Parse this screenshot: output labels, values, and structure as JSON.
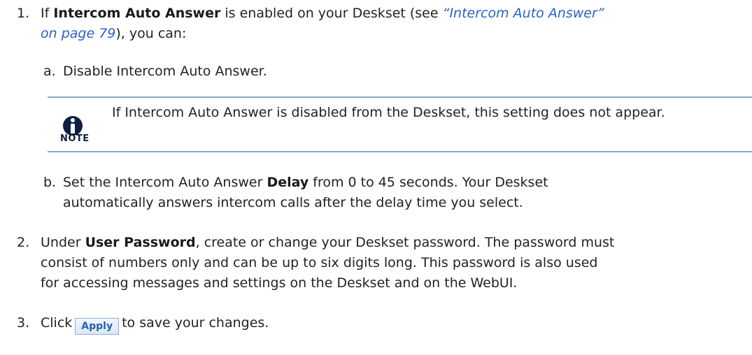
{
  "step1": {
    "number": "1.",
    "prefix": "If ",
    "bold": "Intercom Auto Answer",
    "middle": " is enabled on your Deskset (see ",
    "link_line1": "“Intercom Auto Answer”",
    "link_line2": "on page 79",
    "suffix": "), you can:"
  },
  "substep_a": {
    "letter": "a.",
    "text": "Disable Intercom Auto Answer."
  },
  "note": {
    "icon": "info-icon",
    "label": "NOTE",
    "text": "If Intercom Auto Answer is disabled from the Deskset, this setting does not appear."
  },
  "substep_b": {
    "letter": "b.",
    "prefix": "Set the Intercom Auto Answer ",
    "bold": "Delay",
    "suffix": " from 0 to 45 seconds. Your Deskset",
    "line2": "automatically answers intercom calls after the delay time you select."
  },
  "step2": {
    "number": "2.",
    "prefix": "Under ",
    "bold": "User Password",
    "suffix": ", create or change your Deskset password. The password must",
    "line2": "consist of numbers only and can be up to six digits long. This password is also used",
    "line3": "for accessing messages and settings on the Deskset and on the WebUI."
  },
  "step3": {
    "number": "3.",
    "prefix": "Click",
    "button_label": "Apply",
    "suffix": "to save your changes."
  }
}
